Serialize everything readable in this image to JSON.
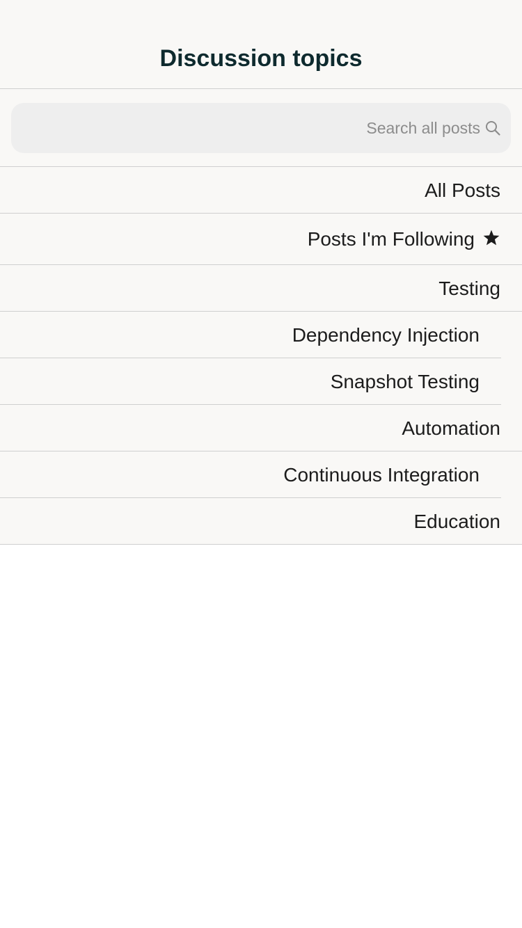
{
  "header": {
    "title": "Discussion topics"
  },
  "search": {
    "placeholder": "Search all posts",
    "value": "",
    "icon": "search-icon"
  },
  "topics": [
    {
      "label": "All Posts",
      "level": "top"
    },
    {
      "label": "Posts I'm Following",
      "level": "top",
      "icon": "star-icon"
    },
    {
      "label": "Testing",
      "level": "top"
    },
    {
      "label": "Dependency Injection",
      "level": "sub"
    },
    {
      "label": "Snapshot Testing",
      "level": "sub"
    },
    {
      "label": "Automation",
      "level": "top"
    },
    {
      "label": "Continuous Integration",
      "level": "sub"
    },
    {
      "label": "Education",
      "level": "top"
    }
  ],
  "colors": {
    "title": "#0e2a2e",
    "list_background": "#f9f8f6",
    "search_background": "#eeeeee",
    "divider": "#cfcfcf"
  }
}
